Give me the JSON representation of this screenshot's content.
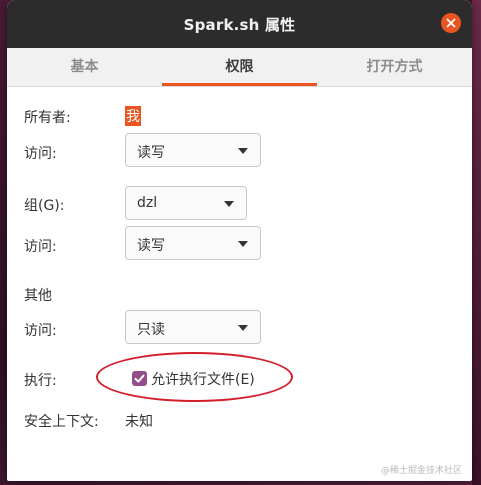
{
  "window": {
    "title": "Spark.sh 属性"
  },
  "tabs": [
    {
      "label": "基本",
      "active": false
    },
    {
      "label": "权限",
      "active": true
    },
    {
      "label": "打开方式",
      "active": false
    }
  ],
  "owner": {
    "label": "所有者:",
    "value": "我",
    "access_label": "访问:",
    "access_value": "读写"
  },
  "group": {
    "label": "组(G):",
    "value": "dzl",
    "access_label": "访问:",
    "access_value": "读写"
  },
  "others": {
    "label": "其他",
    "access_label": "访问:",
    "access_value": "只读"
  },
  "execute": {
    "label": "执行:",
    "checkbox_label": "允许执行文件(E)",
    "checked": true
  },
  "security": {
    "label": "安全上下文:",
    "value": "未知"
  },
  "watermark": "@稀土掘金技术社区",
  "colors": {
    "accent": "#e95420",
    "checkbox": "#924d8b",
    "annotation": "#d21f2b",
    "titlebar": "#2c2c2c"
  }
}
